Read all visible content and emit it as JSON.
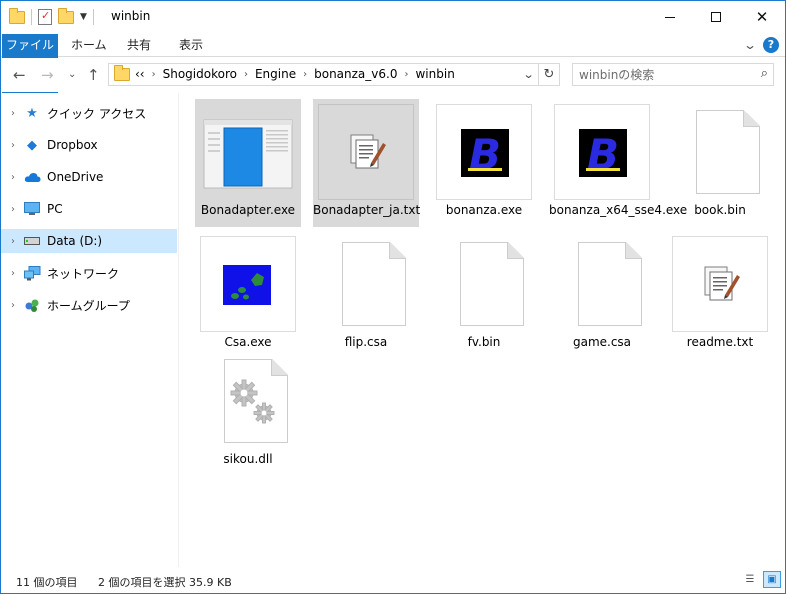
{
  "window": {
    "title": "winbin"
  },
  "ribbon": {
    "tabs": [
      "ファイル",
      "ホーム",
      "共有",
      "表示"
    ]
  },
  "address": {
    "overflow": "‹‹",
    "crumbs": [
      "Shogidokoro",
      "Engine",
      "bonanza_v6.0",
      "winbin"
    ]
  },
  "search": {
    "placeholder": "winbinの検索"
  },
  "nav": {
    "items": [
      {
        "label": "クイック アクセス",
        "icon": "star-icon"
      },
      {
        "label": "Dropbox",
        "icon": "dropbox-icon"
      },
      {
        "label": "OneDrive",
        "icon": "cloud-icon"
      },
      {
        "label": "PC",
        "icon": "monitor-icon"
      },
      {
        "label": "Data (D:)",
        "icon": "drive-icon",
        "selected": true
      },
      {
        "label": "ネットワーク",
        "icon": "network-icon"
      },
      {
        "label": "ホームグループ",
        "icon": "homegroup-icon"
      }
    ]
  },
  "files": [
    {
      "name": "Bonadapter.exe",
      "icon": "app-window-icon",
      "selected": true
    },
    {
      "name": "Bonadapter_ja.txt",
      "icon": "text-document-icon",
      "selected": true
    },
    {
      "name": "bonanza.exe",
      "icon": "bonanza-b-icon"
    },
    {
      "name": "bonanza_x64_sse4.exe",
      "icon": "bonanza-b-icon"
    },
    {
      "name": "book.bin",
      "icon": "blank-file-icon"
    },
    {
      "name": "Csa.exe",
      "icon": "csa-app-icon"
    },
    {
      "name": "flip.csa",
      "icon": "blank-file-icon"
    },
    {
      "name": "fv.bin",
      "icon": "blank-file-icon"
    },
    {
      "name": "game.csa",
      "icon": "blank-file-icon"
    },
    {
      "name": "readme.txt",
      "icon": "text-document-icon"
    },
    {
      "name": "sikou.dll",
      "icon": "dll-gears-icon"
    }
  ],
  "status": {
    "count": "11 個の項目",
    "selection": "2 個の項目を選択  35.9 KB"
  },
  "colors": {
    "accent": "#1979ca",
    "selection": "#cce8ff",
    "file_selected": "#d9d9d9"
  }
}
